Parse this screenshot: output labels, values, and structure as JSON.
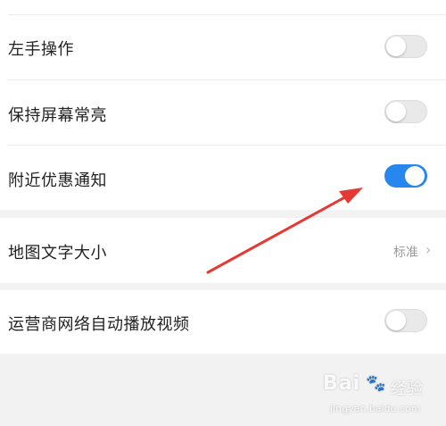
{
  "settings": {
    "left_hand": {
      "label": "左手操作",
      "enabled": false
    },
    "keep_screen_on": {
      "label": "保持屏幕常亮",
      "enabled": false
    },
    "nearby_deals": {
      "label": "附近优惠通知",
      "enabled": true
    },
    "map_text_size": {
      "label": "地图文字大小",
      "value": "标准"
    },
    "carrier_autoplay": {
      "label": "运营商网络自动播放视频",
      "enabled": false
    }
  },
  "watermark": {
    "brand": "Bai",
    "product": "经验",
    "url": "jingyan.baidu.com"
  },
  "colors": {
    "toggle_on": "#2787ee",
    "toggle_off": "#e9e9e9",
    "annotation_arrow": "#e53935",
    "background": "#f2f2f2"
  },
  "icons": {
    "chevron": "chevron-right-icon",
    "paw": "baidu-paw-icon"
  }
}
